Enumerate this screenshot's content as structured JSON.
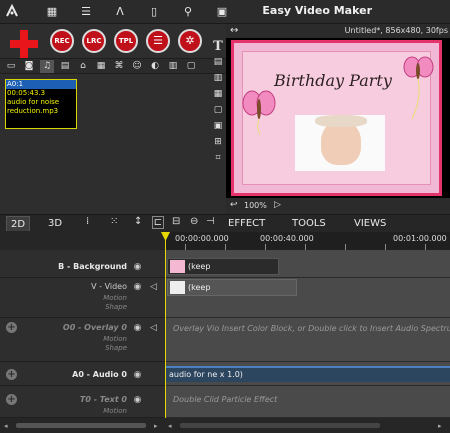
{
  "app": {
    "title": "Easy Video Maker",
    "project_status": "Untitled*, 856x480, 30fps"
  },
  "toolbar": {
    "top_icons": [
      "logo-icon",
      "grid-icon",
      "list-icon",
      "text-style-icon",
      "phone-icon",
      "search-icon",
      "video-icon"
    ],
    "add_label": "add",
    "circle_buttons": [
      {
        "label": "REC",
        "name": "rec-button"
      },
      {
        "label": "LRC",
        "name": "lrc-button"
      },
      {
        "label": "TPL",
        "name": "tpl-button"
      },
      {
        "label": "☰",
        "name": "list-button"
      },
      {
        "label": "✲",
        "name": "effect-button"
      }
    ],
    "right_T": "T"
  },
  "tool_row": [
    "▭",
    "◙",
    "♫",
    "▤",
    "⌂",
    "▦",
    "⌘",
    "☺",
    "◐",
    "▥",
    "▢",
    "▦",
    "▤",
    "▣",
    "▦"
  ],
  "media": {
    "items": [
      {
        "text": "A0:1",
        "highlight": true
      },
      {
        "text": "00:05:43.3",
        "highlight": false
      },
      {
        "text": "audio for noise",
        "highlight": false
      },
      {
        "text": "reduction.mp3",
        "highlight": false
      }
    ]
  },
  "preview": {
    "resize_icon": "↔",
    "card_title": "Birthday Party",
    "zoom": "100%"
  },
  "tabs": {
    "mode_2d": "2D",
    "mode_3d": "3D",
    "menu_effect": "EFFECT",
    "menu_tools": "TOOLS",
    "menu_views": "VIEWS"
  },
  "ruler": {
    "labels": [
      "00:00:00.000",
      "00:00:40.000",
      "00:01:00.000"
    ]
  },
  "tracks": {
    "background": {
      "name": "B - Background",
      "clip": "(keep"
    },
    "video": {
      "name": "V - Video",
      "sub1": "Motion",
      "sub2": "Shape",
      "clip": "(keep"
    },
    "overlay": {
      "name": "O0 - Overlay 0",
      "sub1": "Motion",
      "sub2": "Shape",
      "hint": "Overlay Vio Insert Color Block, or Double click to Insert Audio Spectrum"
    },
    "audio": {
      "name": "A0 - Audio 0",
      "clip": "audio for ne x 1.0)"
    },
    "text": {
      "name": "T0 - Text 0",
      "sub1": "Motion",
      "hint": "Double Clid Particle Effect"
    }
  },
  "colors": {
    "accent_red": "#e8151b",
    "card_pink": "#f0b8d4",
    "card_border": "#e5336c",
    "playhead": "#e6d800"
  }
}
